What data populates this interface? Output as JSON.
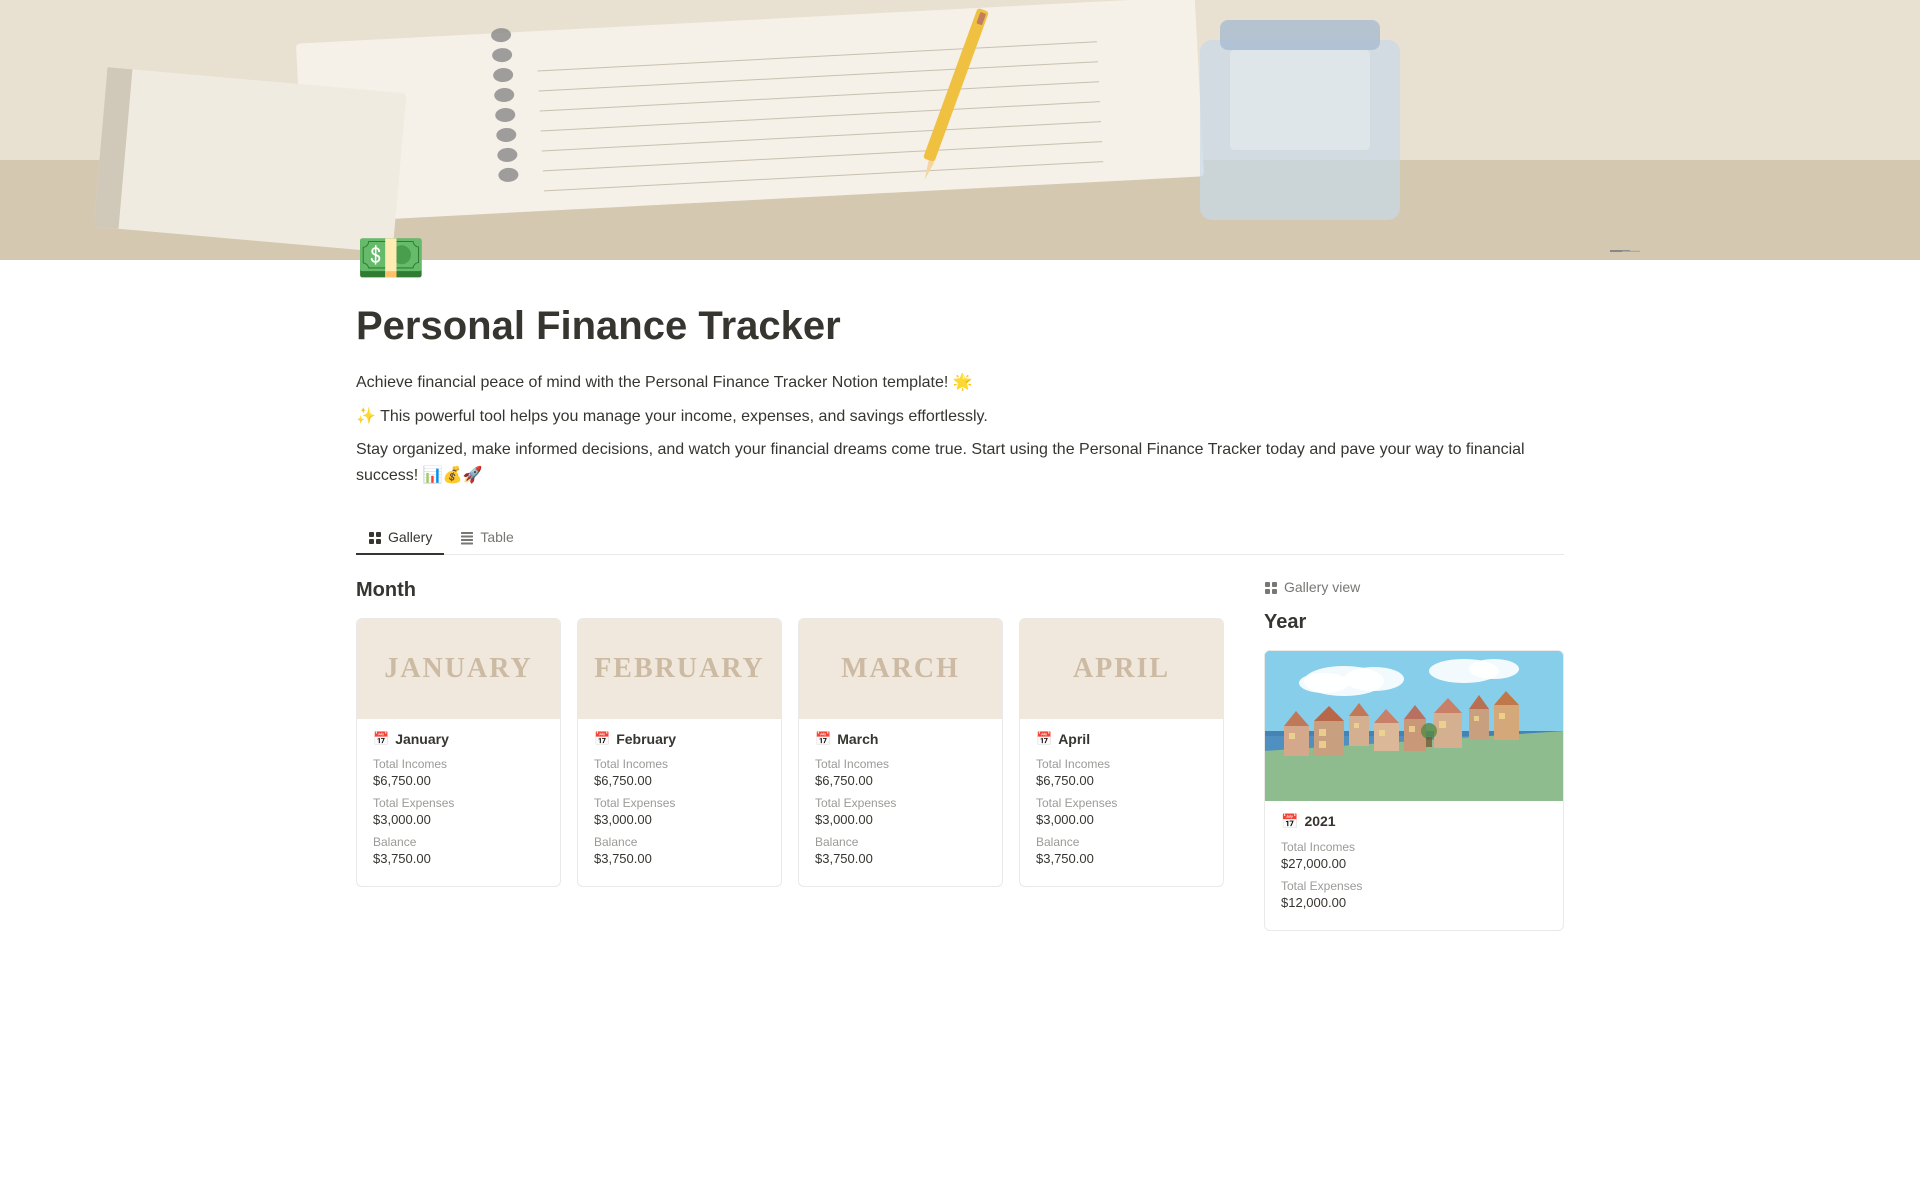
{
  "hero": {
    "alt": "Notebook illustration banner"
  },
  "page": {
    "icon": "💵",
    "title": "Personal Finance Tracker",
    "description1": "Achieve financial peace of mind with the Personal Finance Tracker Notion template! 🌟",
    "description2": "✨ This powerful tool helps you manage your income, expenses, and savings effortlessly.",
    "description3": "Stay organized, make informed decisions, and watch your financial dreams come true. Start using the Personal Finance Tracker today and pave your way to financial success! 📊💰🚀"
  },
  "tabs": [
    {
      "label": "Gallery",
      "icon": "⊞",
      "active": true
    },
    {
      "label": "Table",
      "icon": "⊟",
      "active": false
    }
  ],
  "main_section": {
    "title": "Month"
  },
  "months": [
    {
      "name": "January",
      "cover_text": "January",
      "total_incomes_label": "Total Incomes",
      "total_incomes_value": "$6,750.00",
      "total_expenses_label": "Total Expenses",
      "total_expenses_value": "$3,000.00",
      "balance_label": "Balance",
      "balance_value": "$3,750.00"
    },
    {
      "name": "February",
      "cover_text": "February",
      "total_incomes_label": "Total Incomes",
      "total_incomes_value": "$6,750.00",
      "total_expenses_label": "Total Expenses",
      "total_expenses_value": "$3,000.00",
      "balance_label": "Balance",
      "balance_value": "$3,750.00"
    },
    {
      "name": "March",
      "cover_text": "March",
      "total_incomes_label": "Total Incomes",
      "total_incomes_value": "$6,750.00",
      "total_expenses_label": "Total Expenses",
      "total_expenses_value": "$3,000.00",
      "balance_label": "Balance",
      "balance_value": "$3,750.00"
    },
    {
      "name": "April",
      "cover_text": "April",
      "total_incomes_label": "Total Incomes",
      "total_incomes_value": "$6,750.00",
      "total_expenses_label": "Total Expenses",
      "total_expenses_value": "$3,000.00",
      "balance_label": "Balance",
      "balance_value": "$3,750.00"
    }
  ],
  "sidebar": {
    "view_label": "Gallery view",
    "year_section_title": "Year",
    "years": [
      {
        "name": "2021",
        "total_incomes_label": "Total Incomes",
        "total_incomes_value": "$27,000.00",
        "total_expenses_label": "Total Expenses",
        "total_expenses_value": "$12,000.00"
      }
    ]
  },
  "icons": {
    "gallery": "⊞",
    "table": "⊟",
    "calendar": "📅",
    "minimize": "—"
  }
}
